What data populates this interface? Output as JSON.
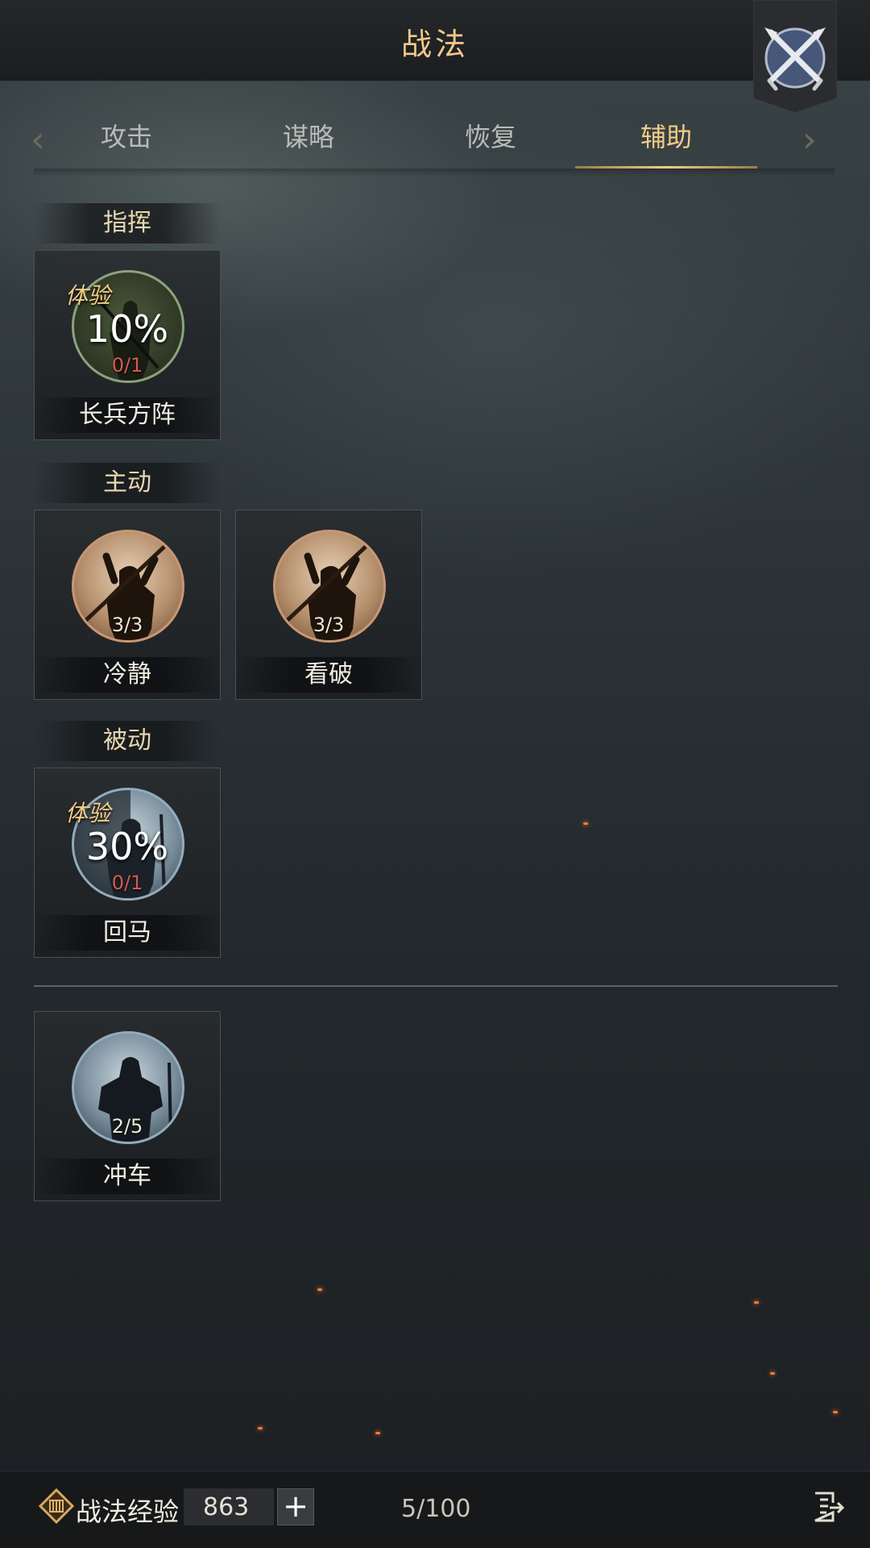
{
  "header": {
    "title": "战法",
    "badge_icon": "crossed-swords-icon"
  },
  "tabs": [
    {
      "label": "攻击",
      "active": false
    },
    {
      "label": "谋略",
      "active": false
    },
    {
      "label": "恢复",
      "active": false
    },
    {
      "label": "辅助",
      "active": true
    }
  ],
  "sections": [
    {
      "title": "指挥",
      "cards": [
        {
          "name": "长兵方阵",
          "count": "0/1",
          "trial_label": "体验",
          "percent": "10%",
          "style": "green"
        }
      ]
    },
    {
      "title": "主动",
      "cards": [
        {
          "name": "冷静",
          "count": "3/3",
          "style": "bronze"
        },
        {
          "name": "看破",
          "count": "3/3",
          "style": "bronze"
        }
      ]
    },
    {
      "title": "被动",
      "cards": [
        {
          "name": "回马",
          "count": "0/1",
          "trial_label": "体验",
          "percent": "30%",
          "style": "steel"
        }
      ]
    },
    {
      "title": "",
      "cards": [
        {
          "name": "冲车",
          "count": "2/5",
          "style": "steel"
        }
      ]
    }
  ],
  "footer": {
    "exp_label": "战法经验",
    "exp_value": "863",
    "add_label": "+",
    "capacity": "5/100"
  },
  "colors": {
    "accent": "#f3cc86",
    "trial_text": "#f6cd84",
    "count_red": "#d75a4d"
  }
}
